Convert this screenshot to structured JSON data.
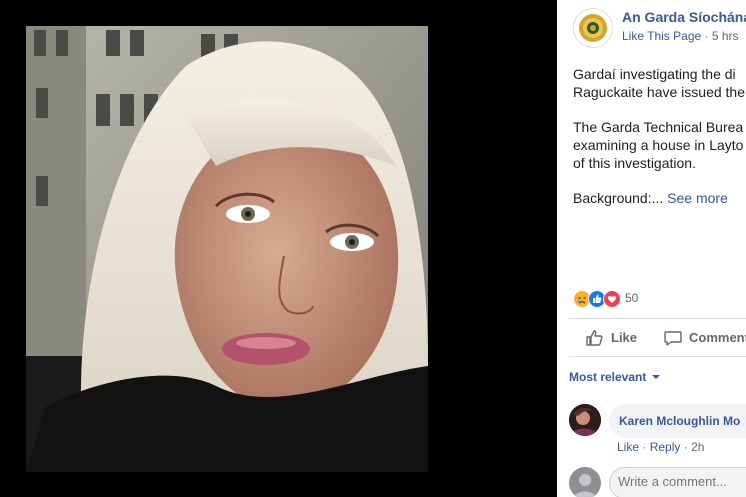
{
  "post": {
    "page_name": "An Garda Síochána",
    "like_page": "Like This Page",
    "separator": "·",
    "time": "5 hrs",
    "lines_p1": [
      "Gardaí investigating the di",
      "Raguckaite have issued the"
    ],
    "lines_p2": [
      "The Garda Technical Burea",
      "examining a house in Layto",
      "of this investigation."
    ],
    "background_label": "Background:...",
    "see_more": "See more"
  },
  "reactions": {
    "count": "50",
    "types": [
      "sad",
      "like",
      "love"
    ],
    "colors": {
      "sad": "#f7b125",
      "like": "#1877f2",
      "love": "#f33e58"
    }
  },
  "actions": {
    "like": "Like",
    "comment": "Comment"
  },
  "comments": {
    "sort_label": "Most relevant",
    "items": [
      {
        "author": "Karen Mcloughlin Mo",
        "like": "Like",
        "reply": "Reply",
        "separator": "·",
        "time": "2h"
      }
    ],
    "composer_placeholder": "Write a comment..."
  },
  "icons": [
    "garda-badge-icon",
    "sad-reaction-icon",
    "like-reaction-icon",
    "love-reaction-icon",
    "thumbs-up-icon",
    "comment-icon",
    "caret-down-icon"
  ],
  "colors": {
    "link": "#385898",
    "meta": "#606770",
    "text": "#1c1e21"
  }
}
